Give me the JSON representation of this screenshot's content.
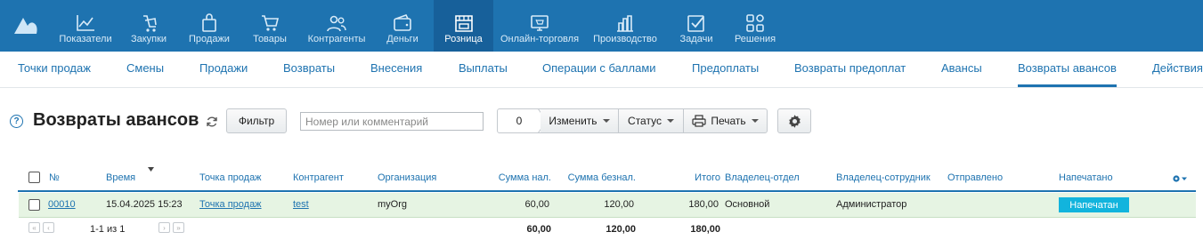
{
  "nav": {
    "items": [
      {
        "label": "Показатели",
        "icon": "chart-line-icon"
      },
      {
        "label": "Закупки",
        "icon": "bag-cart-icon"
      },
      {
        "label": "Продажи",
        "icon": "shopping-bag-icon"
      },
      {
        "label": "Товары",
        "icon": "cart-icon"
      },
      {
        "label": "Контрагенты",
        "icon": "users-icon"
      },
      {
        "label": "Деньги",
        "icon": "wallet-icon"
      },
      {
        "label": "Розница",
        "icon": "store-icon"
      },
      {
        "label": "Онлайн-торговля",
        "icon": "online-store-icon"
      },
      {
        "label": "Производство",
        "icon": "production-chart-icon"
      },
      {
        "label": "Задачи",
        "icon": "task-check-icon"
      },
      {
        "label": "Решения",
        "icon": "apps-grid-icon"
      }
    ],
    "active": "Розница"
  },
  "subnav": {
    "items": [
      "Точки продаж",
      "Смены",
      "Продажи",
      "Возвраты",
      "Внесения",
      "Выплаты",
      "Операции с баллами",
      "Предоплаты",
      "Возвраты предоплат",
      "Авансы",
      "Возвраты авансов",
      "Действия"
    ],
    "active": "Возвраты авансов"
  },
  "toolbar": {
    "title": "Возвраты авансов",
    "help": "?",
    "filter_label": "Фильтр",
    "search_placeholder": "Номер или комментарий",
    "counter": "0",
    "change_label": "Изменить",
    "status_label": "Статус",
    "print_label": "Печать"
  },
  "table": {
    "columns": [
      "№",
      "Время",
      "Точка продаж",
      "Контрагент",
      "Организация",
      "Сумма нал.",
      "Сумма безнал.",
      "Итого",
      "Владелец-отдел",
      "Владелец-сотрудник",
      "Отправлено",
      "Напечатано"
    ],
    "rows": [
      {
        "number": "00010",
        "time": "15.04.2025 15:23",
        "point": "Точка продаж",
        "counterparty": "test",
        "organization": "myOrg",
        "cash": "60,00",
        "noncash": "120,00",
        "total": "180,00",
        "department": "Основной",
        "employee": "Администратор",
        "sent": "",
        "printed": "Напечатан"
      }
    ],
    "footer": {
      "pagination": "1-1 из 1",
      "cash_total": "60,00",
      "noncash_total": "120,00",
      "grand_total": "180,00"
    }
  },
  "colors": {
    "accent": "#1e73b0",
    "active_nav": "#17609a",
    "row_bg": "#e6f4e3",
    "badge": "#12b4dd"
  }
}
